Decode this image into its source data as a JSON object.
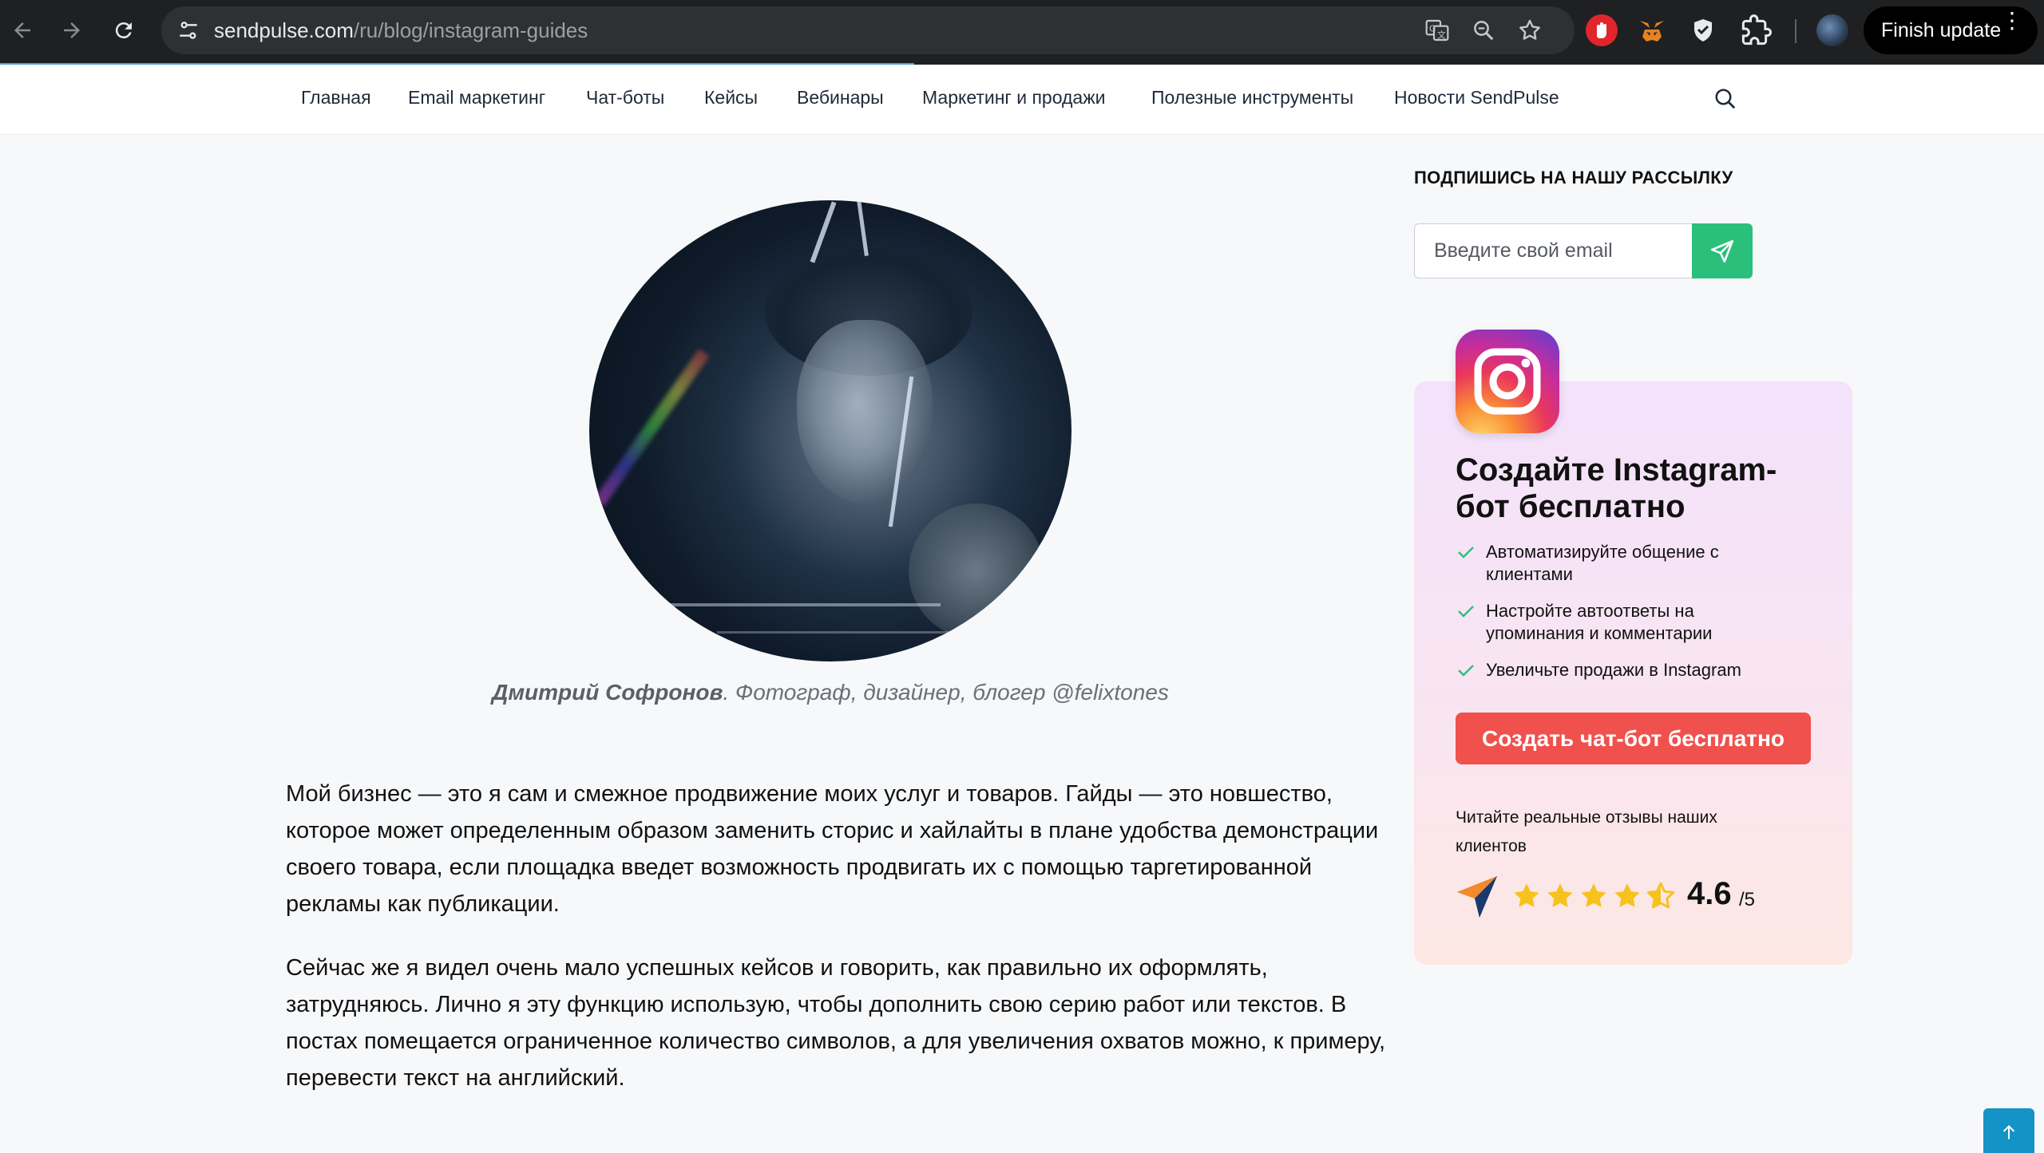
{
  "browser": {
    "url_host": "sendpulse.com",
    "url_path": "/ru/blog/instagram-guides",
    "finish_update_label": "Finish update",
    "menu_dots": "⋮"
  },
  "nav": {
    "items": [
      "Главная",
      "Email маркетинг",
      "Чат-боты",
      "Кейсы",
      "Вебинары",
      "Маркетинг и продажи",
      "Полезные инструменты",
      "Новости SendPulse"
    ]
  },
  "article": {
    "caption_name": "Дмитрий Софронов",
    "caption_rest": ". Фотограф, дизайнер, блогер @felixtones",
    "paragraphs": [
      "Мой бизнес — это я сам и смежное продвижение моих услуг и товаров. Гайды — это новшество, которое может определенным образом заменить сторис и хайлайты в плане удобства демонстрации своего товара, если площадка введет возможность продвигать их с помощью таргетированной рекламы как публикации.",
      "Сейчас же я видел очень мало успешных кейсов и говорить, как правильно их оформлять, затрудняюсь. Лично я эту функцию использую, чтобы дополнить свою серию работ или текстов. В постах помещается ограниченное количество символов, а для увеличения охватов можно, к примеру, перевести текст на английский."
    ]
  },
  "sidebar": {
    "subscribe_title": "ПОДПИШИСЬ НА НАШУ РАССЫЛКУ",
    "email_placeholder": "Введите свой email",
    "promo": {
      "title": "Создайте Instagram-бот бесплатно",
      "features": [
        "Автоматизируйте общение с клиентами",
        "Настройте автоответы на упоминания и комментарии",
        "Увеличьте продажи в Instagram"
      ],
      "cta_label": "Создать чат-бот бесплатно",
      "reviews_text": "Читайте реальные отзывы наших клиентов",
      "rating_value": "4.6",
      "rating_max": "/5",
      "rating_stars": 4.5
    }
  },
  "colors": {
    "accent_green": "#2bbf7c",
    "cta_red": "#f0514d",
    "check_green": "#2bbf7c",
    "star_yellow": "#f7c21e",
    "scroll_top_blue": "#1493c7"
  },
  "icons": {
    "back": "arrow-left-icon",
    "forward": "arrow-right-icon",
    "reload": "reload-icon",
    "site_settings": "tune-icon",
    "translate": "translate-icon",
    "zoom": "zoom-icon",
    "bookmark": "star-icon",
    "extensions": "puzzle-icon",
    "search": "search-icon",
    "send": "send-icon",
    "scroll_top": "arrow-up-icon"
  }
}
